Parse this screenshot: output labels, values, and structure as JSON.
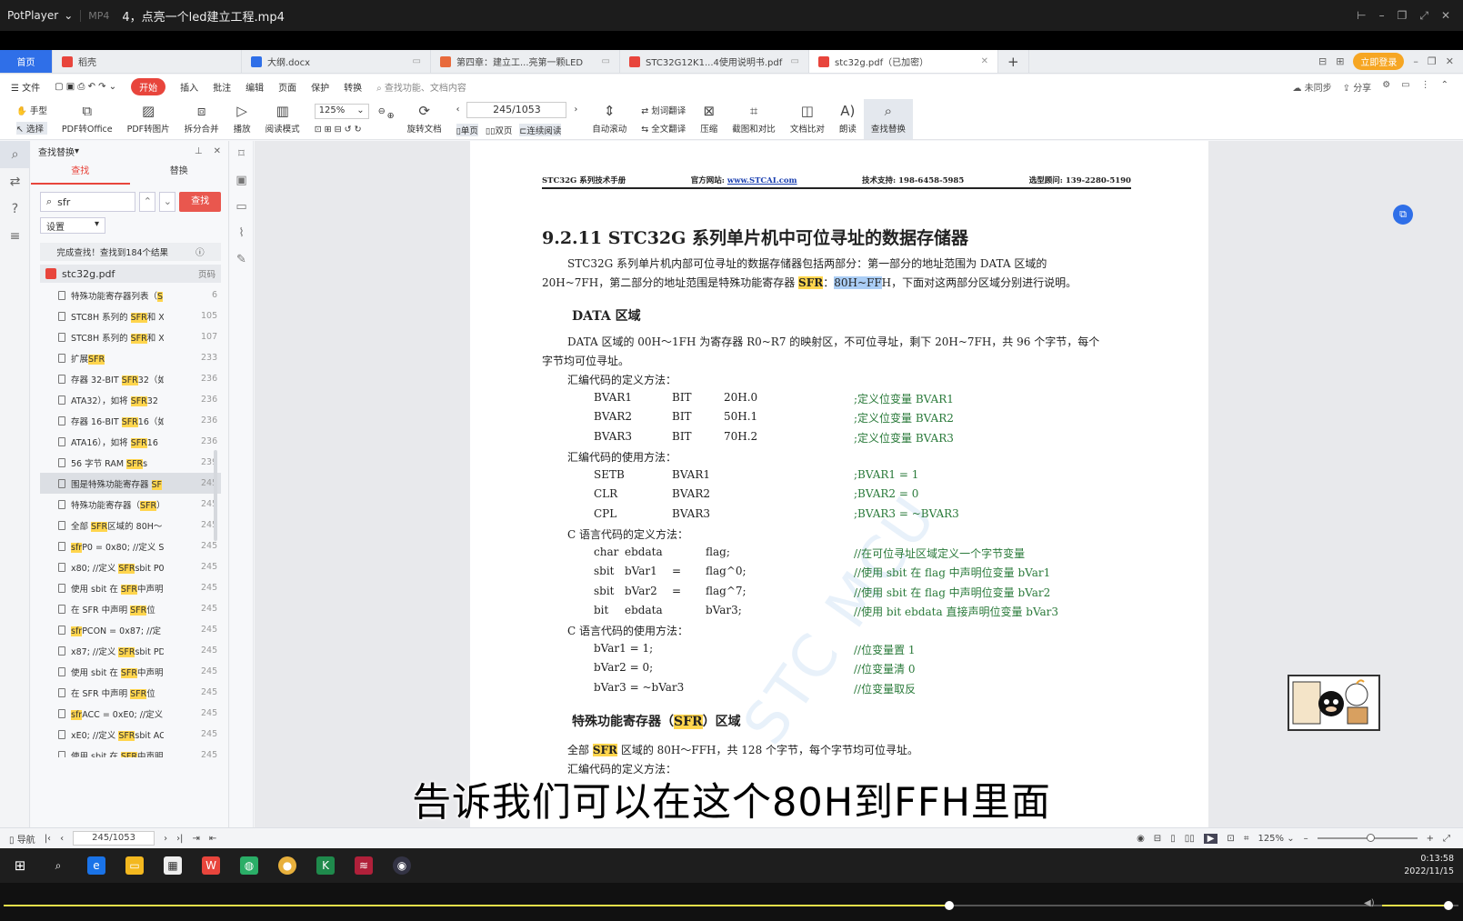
{
  "player": {
    "app": "PotPlayer",
    "format": "MP4",
    "title": "4，点亮一个led建立工程.mp4"
  },
  "tabs": [
    {
      "label": "首页"
    },
    {
      "label": "稻壳"
    },
    {
      "label": "大纲.docx"
    },
    {
      "label": "第四章：建立工...亮第一颗LED"
    },
    {
      "label": "STC32G12K1...4使用说明书.pdf"
    },
    {
      "label": "stc32g.pdf（已加密）"
    }
  ],
  "login": "立即登录",
  "menu": {
    "items": [
      "文件",
      "开始",
      "插入",
      "批注",
      "编辑",
      "页面",
      "保护",
      "转换"
    ],
    "search": "查找功能、文档内容",
    "sync": "未同步",
    "share": "分享"
  },
  "toolbar": {
    "hand": "手型",
    "select": "选择",
    "pdf2office": "PDF转Office",
    "pdf2img": "PDF转图片",
    "split": "拆分合并",
    "play": "播放",
    "readmode": "阅读模式",
    "zoom": "125%",
    "page": "245/1053",
    "single": "单页",
    "double": "双页",
    "continuous": "连续阅读",
    "autoscroll": "自动滚动",
    "translate": "划词翻译",
    "fulltrans": "全文翻译",
    "compress": "压缩",
    "screenshot": "截图和对比",
    "compare": "文档比对",
    "read": "朗读",
    "findreplace": "查找替换"
  },
  "find": {
    "title": "查找替换",
    "tab_find": "查找",
    "tab_replace": "替换",
    "query": "sfr",
    "button": "查找",
    "settings": "设置",
    "done": "完成查找！查找到184个结果",
    "file": "stc32g.pdf",
    "page_col": "页码",
    "results": [
      {
        "pre": "特殊功能寄存器列表（",
        "hl": "S",
        "post": "",
        "page": "6"
      },
      {
        "pre": "STC8H 系列的 ",
        "hl": "SFR",
        "post": "和 X",
        "page": "105"
      },
      {
        "pre": "STC8H 系列的 ",
        "hl": "SFR",
        "post": "和 X",
        "page": "107"
      },
      {
        "pre": "扩展",
        "hl": "SFR",
        "post": "",
        "page": "233"
      },
      {
        "pre": "存器 32-BIT ",
        "hl": "SFR",
        "post": "32（如",
        "page": "236"
      },
      {
        "pre": "ATA32），如将 ",
        "hl": "SFR",
        "post": "32",
        "page": "236"
      },
      {
        "pre": "存器 16-BIT ",
        "hl": "SFR",
        "post": "16（如",
        "page": "236"
      },
      {
        "pre": "ATA16），如将 ",
        "hl": "SFR",
        "post": "16",
        "page": "236"
      },
      {
        "pre": "56 字节 RAM ",
        "hl": "SFR",
        "post": "s",
        "page": "239"
      },
      {
        "pre": "围是特殊功能寄存器 ",
        "hl": "SF",
        "post": "",
        "page": "245"
      },
      {
        "pre": "特殊功能寄存器（",
        "hl": "SFR",
        "post": "）",
        "page": "245"
      },
      {
        "pre": "全部 ",
        "hl": "SFR",
        "post": "区域的 80H～",
        "page": "245"
      },
      {
        "pre": "",
        "hl": "sfr",
        "post": "P0 = 0x80; //定义 S",
        "page": "245"
      },
      {
        "pre": "x80; //定义 ",
        "hl": "SFR",
        "post": "sbit P0",
        "page": "245"
      },
      {
        "pre": "使用 sbit 在 ",
        "hl": "SFR",
        "post": "中声明",
        "page": "245"
      },
      {
        "pre": "在 SFR 中声明 ",
        "hl": "SFR",
        "post": "位",
        "page": "245"
      },
      {
        "pre": "",
        "hl": "sfr",
        "post": "PCON = 0x87; //定",
        "page": "245"
      },
      {
        "pre": "x87; //定义 ",
        "hl": "SFR",
        "post": "sbit PD",
        "page": "245"
      },
      {
        "pre": "使用 sbit 在 ",
        "hl": "SFR",
        "post": "中声明",
        "page": "245"
      },
      {
        "pre": "在 SFR 中声明 ",
        "hl": "SFR",
        "post": "位",
        "page": "245"
      },
      {
        "pre": "",
        "hl": "sfr",
        "post": "ACC = 0xE0; //定义",
        "page": "245"
      },
      {
        "pre": "xE0; //定义 ",
        "hl": "SFR",
        "post": "sbit AC",
        "page": "245"
      },
      {
        "pre": "使用 sbit 在 ",
        "hl": "SFR",
        "post": "中声明",
        "page": "245"
      }
    ]
  },
  "doc": {
    "header": {
      "left": "STC32G 系列技术手册",
      "site_label": "官方网站: ",
      "site": "www.STCAI.com",
      "support": "技术支持: 198-6458-5985",
      "advisor": "选型顾问: 139-2280-5190"
    },
    "heading": "9.2.11  STC32G 系列单片机中可位寻址的数据存储器",
    "intro_a": "STC32G  系列单片机内部可位寻址的数据存储器包括两部分：第一部分的地址范围为  DATA  区域的",
    "intro_b1": "20H~7FH，第二部分的地址范围是特殊功能寄存器 ",
    "intro_sfr": "SFR",
    "intro_b2": "：",
    "intro_sel": "80H~FF",
    "intro_b3": "H，下面对这两部分区域分别进行说明。",
    "data_heading": "DATA 区域",
    "data_p1": "DATA 区域的 00H～1FH 为寄存器 R0~R7 的映射区，不可位寻址，剩下 20H~7FH，共 96 个字节，每个",
    "data_p2": "字节均可位寻址。",
    "asm_def": "汇编代码的定义方法：",
    "asm_def_rows": [
      [
        "BVAR1",
        "BIT",
        "20H.0",
        ";定义位变量 BVAR1"
      ],
      [
        "BVAR2",
        "BIT",
        "50H.1",
        ";定义位变量 BVAR2"
      ],
      [
        "BVAR3",
        "BIT",
        "70H.2",
        ";定义位变量 BVAR3"
      ]
    ],
    "asm_use": "汇编代码的使用方法：",
    "asm_use_rows": [
      [
        "SETB",
        "BVAR1",
        ";BVAR1 = 1"
      ],
      [
        "CLR",
        "BVAR2",
        ";BVAR2 = 0"
      ],
      [
        "CPL",
        "BVAR3",
        ";BVAR3 = ~BVAR3"
      ]
    ],
    "c_def": "C 语言代码的定义方法：",
    "c_def_rows": [
      [
        "char",
        "ebdata",
        "",
        "flag;",
        "//在可位寻址区域定义一个字节变量"
      ],
      [
        "sbit",
        "bVar1",
        "=",
        "flag^0;",
        "//使用 sbit 在 flag 中声明位变量 bVar1"
      ],
      [
        "sbit",
        "bVar2",
        "=",
        "flag^7;",
        "//使用 sbit 在 flag 中声明位变量 bVar2"
      ],
      [
        "bit",
        "ebdata",
        "",
        "bVar3;",
        "//使用 bit ebdata 直接声明位变量 bVar3"
      ]
    ],
    "c_use": "C 语言代码的使用方法：",
    "c_use_rows": [
      [
        "bVar1 = 1;",
        "//位变量置 1"
      ],
      [
        "bVar2 = 0;",
        "//位变量清 0"
      ],
      [
        "bVar3 = ~bVar3",
        "//位变量取反"
      ]
    ],
    "sfr_heading_a": "特殊功能寄存器（",
    "sfr_heading_b": "SFR",
    "sfr_heading_c": "）区域",
    "sfr_p_a": "全部 ",
    "sfr_p_b": "SFR",
    "sfr_p_c": " 区域的 80H～FFH，共 128 个字节，每个字节均可位寻址。",
    "sfr_p2": "汇编代码的定义方法：",
    "watermark": "STC MCU"
  },
  "subtitle": "告诉我们可以在这个80H到FFH里面",
  "status": {
    "nav": "导航",
    "page": "245/1053",
    "zoom": "125%"
  },
  "clock": {
    "time": "0:13:58",
    "date": "2022/11/15"
  },
  "playback": {
    "progress": 0.65,
    "volume": 0.95
  }
}
